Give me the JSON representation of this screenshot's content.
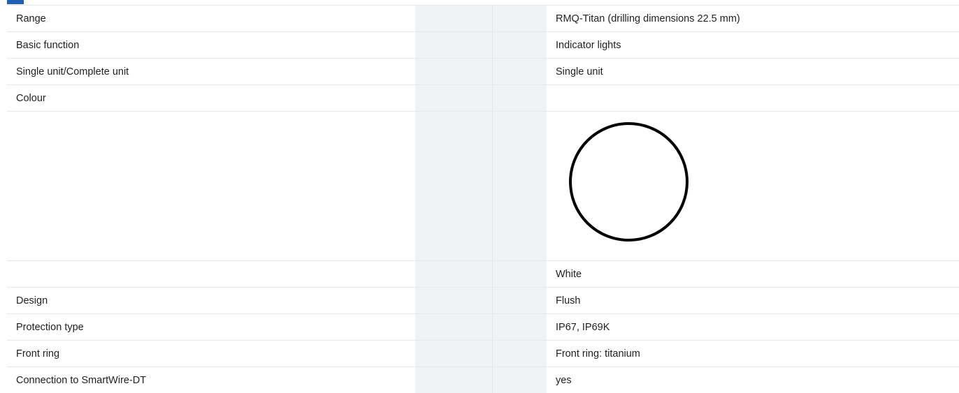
{
  "colors": {
    "accent": "#1f5fb6",
    "gap_column": "#f1f2f6",
    "row_divider": "#e5e7eb",
    "swatch_fill": "#ffffff",
    "swatch_border": "#000000"
  },
  "specs": [
    {
      "label": "Range",
      "value": "RMQ-Titan (drilling dimensions 22.5 mm)"
    },
    {
      "label": "Basic function",
      "value": "Indicator lights"
    },
    {
      "label": "Single unit/Complete unit",
      "value": "Single unit"
    },
    {
      "label": "Colour",
      "value": ""
    },
    {
      "label": "",
      "value": "",
      "swatch": "white-circle-swatch"
    },
    {
      "label": "",
      "value": "White"
    },
    {
      "label": "Design",
      "value": "Flush"
    },
    {
      "label": "Protection type",
      "value": "IP67, IP69K"
    },
    {
      "label": "Front ring",
      "value": "Front ring: titanium"
    },
    {
      "label": "Connection to SmartWire-DT",
      "value": "yes"
    }
  ]
}
